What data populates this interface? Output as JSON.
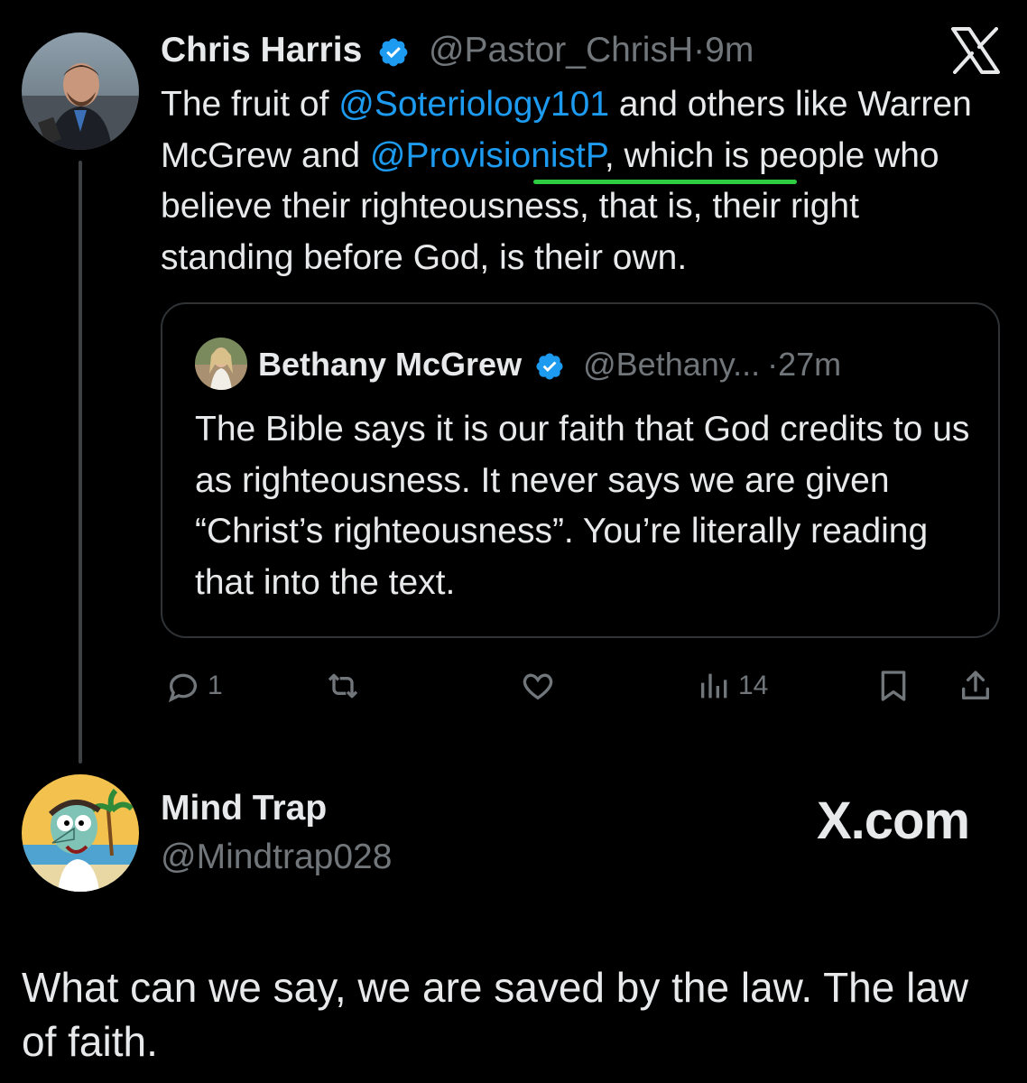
{
  "tweet": {
    "author_name": "Chris Harris",
    "handle": "@Pastor_ChrisH",
    "separator": "·",
    "time": "9m",
    "body_parts": [
      {
        "text": "The fruit of ",
        "mention": false
      },
      {
        "text": "@Soteriology101",
        "mention": true
      },
      {
        "text": " and others like Warren McGrew and ",
        "mention": false
      },
      {
        "text": "@ProvisionistP",
        "mention": true
      },
      {
        "text": ", which is people who believe their righteousness, that is, their right standing before God, is their own.",
        "mention": false
      }
    ]
  },
  "quote": {
    "author_name": "Bethany McGrew",
    "handle": "@Bethany...",
    "separator": "·",
    "time": "27m",
    "body": "The Bible says it is our faith that God credits to us as righteousness. It never says we are given “Christ’s righteousness”. You’re literally reading that into the text."
  },
  "actions": {
    "replies": "1",
    "retweets": "",
    "likes": "",
    "views": "14"
  },
  "reply": {
    "author_name": "Mind Trap",
    "handle": "@Mindtrap028",
    "watermark": "X.com",
    "text": "What can we say, we are saved by the law.  The law of faith."
  },
  "colors": {
    "background": "#000000",
    "text": "#e7e9ea",
    "muted": "#71767b",
    "mention": "#1d9bf0",
    "verified": "#1d9bf0",
    "highlight_underline": "#2ecc40"
  },
  "icons": [
    "verified-badge-icon",
    "x-logo-icon",
    "reply-icon",
    "retweet-icon",
    "like-icon",
    "views-icon",
    "bookmark-icon",
    "share-icon"
  ]
}
